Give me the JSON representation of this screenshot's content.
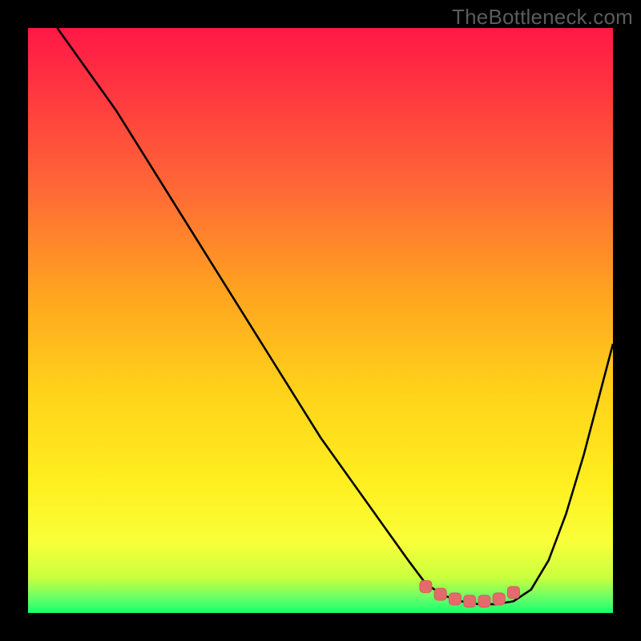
{
  "watermark": "TheBottleneck.com",
  "colors": {
    "frame": "#000000",
    "watermark": "#5b5b5b",
    "line": "#000000",
    "marker_fill": "#e46b6b",
    "marker_stroke": "#d85a5a",
    "gradient_stops": [
      {
        "offset": 0.0,
        "color": "#ff1846"
      },
      {
        "offset": 0.12,
        "color": "#ff3a3f"
      },
      {
        "offset": 0.28,
        "color": "#ff6a36"
      },
      {
        "offset": 0.45,
        "color": "#ffa31f"
      },
      {
        "offset": 0.62,
        "color": "#ffd21a"
      },
      {
        "offset": 0.78,
        "color": "#ffef20"
      },
      {
        "offset": 0.88,
        "color": "#f8ff3a"
      },
      {
        "offset": 0.94,
        "color": "#c9ff3e"
      },
      {
        "offset": 0.975,
        "color": "#66ff68"
      },
      {
        "offset": 1.0,
        "color": "#18ff6e"
      }
    ]
  },
  "chart_data": {
    "type": "line",
    "title": "",
    "xlabel": "",
    "ylabel": "",
    "xlim": [
      0,
      100
    ],
    "ylim": [
      0,
      100
    ],
    "grid": false,
    "legend": false,
    "series": [
      {
        "name": "bottleneck-curve",
        "x": [
          5,
          10,
          15,
          20,
          25,
          30,
          35,
          40,
          45,
          50,
          55,
          60,
          65,
          68,
          71,
          74,
          77,
          80,
          83,
          86,
          89,
          92,
          95,
          100
        ],
        "values": [
          100,
          93,
          86,
          78,
          70,
          62,
          54,
          46,
          38,
          30,
          23,
          16,
          9,
          5,
          3,
          2,
          1.5,
          1.5,
          2,
          4,
          9,
          17,
          27,
          46
        ]
      }
    ],
    "markers": {
      "name": "optimal-range",
      "x": [
        68,
        70.5,
        73,
        75.5,
        78,
        80.5,
        83
      ],
      "values": [
        4.5,
        3.2,
        2.4,
        2.0,
        2.0,
        2.4,
        3.5
      ]
    }
  }
}
